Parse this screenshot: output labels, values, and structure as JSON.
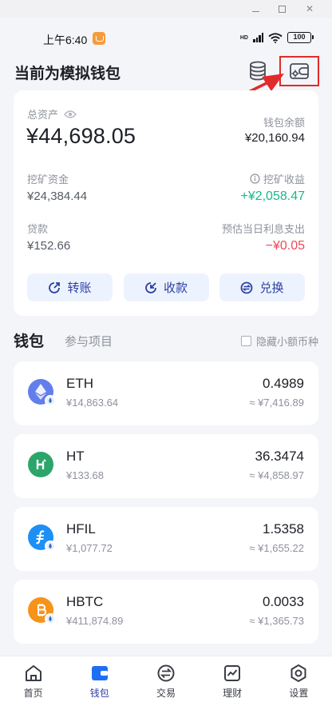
{
  "status_bar": {
    "time": "上午6:40",
    "network_label": "HD",
    "battery": "100"
  },
  "header": {
    "title": "当前为模拟钱包"
  },
  "asset_card": {
    "total_label": "总资产",
    "total_value": "¥44,698.05",
    "wallet_balance_label": "钱包余额",
    "wallet_balance_value": "¥20,160.94",
    "mining_fund_label": "挖矿资金",
    "mining_fund_value": "¥24,384.44",
    "mining_income_label": "挖矿收益",
    "mining_income_value": "+¥2,058.47",
    "loan_label": "贷款",
    "loan_value": "¥152.66",
    "interest_label": "预估当日利息支出",
    "interest_value": "−¥0.05",
    "actions": [
      {
        "label": "转账",
        "icon": "transfer-icon"
      },
      {
        "label": "收款",
        "icon": "receive-icon"
      },
      {
        "label": "兑换",
        "icon": "exchange-icon"
      }
    ]
  },
  "tabs": {
    "wallet": "钱包",
    "projects": "参与项目",
    "hide_small": "隐藏小额币种"
  },
  "coins": [
    {
      "symbol": "ETH",
      "price": "¥14,863.64",
      "amount": "0.4989",
      "fiat": "≈ ¥7,416.89",
      "color": "#627eea"
    },
    {
      "symbol": "HT",
      "price": "¥133.68",
      "amount": "36.3474",
      "fiat": "≈ ¥4,858.97",
      "color": "#2ca56a"
    },
    {
      "symbol": "HFIL",
      "price": "¥1,077.72",
      "amount": "1.5358",
      "fiat": "≈ ¥1,655.22",
      "color": "#1e8ff5"
    },
    {
      "symbol": "HBTC",
      "price": "¥411,874.89",
      "amount": "0.0033",
      "fiat": "≈ ¥1,365.73",
      "color": "#f7931a"
    }
  ],
  "bottom_nav": [
    {
      "label": "首页",
      "icon": "home-icon"
    },
    {
      "label": "钱包",
      "icon": "wallet-icon"
    },
    {
      "label": "交易",
      "icon": "trade-icon"
    },
    {
      "label": "理财",
      "icon": "finance-icon"
    },
    {
      "label": "设置",
      "icon": "settings-icon"
    }
  ],
  "colors": {
    "accent": "#2c3fa5",
    "positive": "#16b98a",
    "negative": "#ec4b5c",
    "annotation": "#e22a2a"
  }
}
